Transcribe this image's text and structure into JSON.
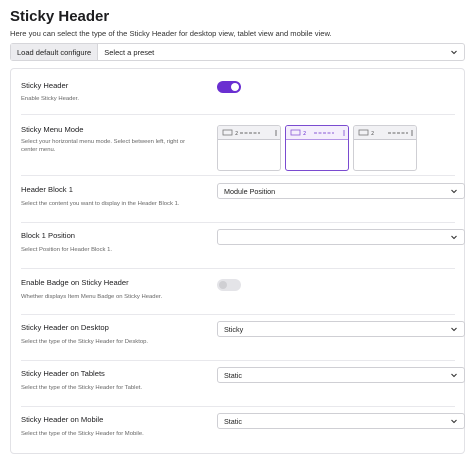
{
  "page": {
    "title": "Sticky Header",
    "description": "Here you can select the type of the Sticky Header for desktop view, tablet view and mobile view."
  },
  "preset": {
    "button_label": "Load default configure",
    "select_value": "Select a preset"
  },
  "settings": [
    {
      "id": "sticky-header",
      "label": "Sticky Header",
      "help": "Enable Sticky Header.",
      "control": "toggle",
      "on": true
    },
    {
      "id": "sticky-menu-mode",
      "label": "Sticky Menu Mode",
      "help": "Select your horizontal menu mode. Select between left, right or center menu.",
      "control": "modes",
      "selected": 1
    },
    {
      "id": "header-block-1",
      "label": "Header Block 1",
      "help": "Select the content you want to display in the Header Block 1.",
      "control": "select",
      "value": "Module Position"
    },
    {
      "id": "block-1-position",
      "label": "Block 1 Position",
      "help": "Select Position for Header Block 1.",
      "control": "select",
      "value": ""
    },
    {
      "id": "enable-badge",
      "label": "Enable Badge on Sticky Header",
      "help": "Whether displays Item Menu Badge on Sticky Header.",
      "control": "toggle",
      "on": false
    },
    {
      "id": "sticky-desktop",
      "label": "Sticky Header on Desktop",
      "help": "Select the type of the Sticky Header for Desktop.",
      "control": "select",
      "value": "Sticky"
    },
    {
      "id": "sticky-tablets",
      "label": "Sticky Header on Tablets",
      "help": "Select the type of the Sticky Header for Tablet.",
      "control": "select",
      "value": "Static"
    },
    {
      "id": "sticky-mobile",
      "label": "Sticky Header on Mobile",
      "help": "Select the type of the Sticky Header for Mobile.",
      "control": "select",
      "value": "Static"
    }
  ],
  "colors": {
    "accent": "#6a2fd1",
    "border": "#cfcfd4"
  },
  "icons": {
    "select_arrow": "chevron-down-icon"
  }
}
